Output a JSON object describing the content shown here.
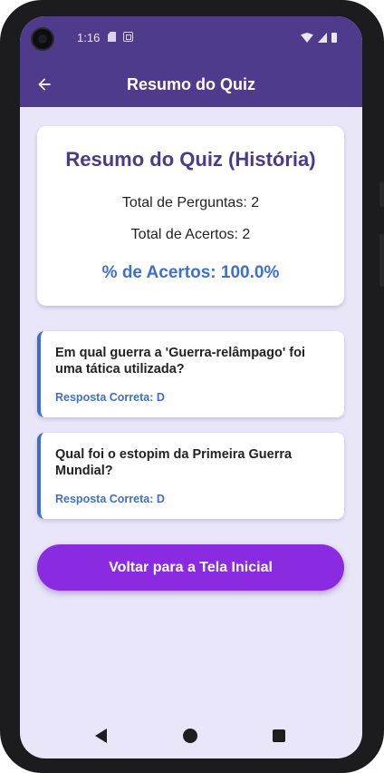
{
  "status_bar": {
    "time": "1:16"
  },
  "app_bar": {
    "title": "Resumo do Quiz"
  },
  "summary": {
    "title": "Resumo do Quiz (História)",
    "total_questions": "Total de Perguntas: 2",
    "total_correct": "Total de Acertos: 2",
    "percent_correct": "% de Acertos: 100.0%"
  },
  "questions": [
    {
      "text": "Em qual guerra a 'Guerra-relâmpago' foi uma tática utilizada?",
      "answer": "Resposta Correta: D"
    },
    {
      "text": "Qual foi o estopim da Primeira Guerra Mundial?",
      "answer": "Resposta Correta: D"
    }
  ],
  "home_button": {
    "label": "Voltar para a Tela Inicial"
  },
  "colors": {
    "app_bar": "#4f3b8b",
    "background": "#e8e6f8",
    "accent_blue": "#3d6fd1",
    "button_purple": "#8a2be2",
    "title_purple": "#4b3a8c"
  },
  "icons": {
    "back": "arrow-left-icon",
    "nav_back": "triangle-back-icon",
    "nav_home": "circle-home-icon",
    "nav_recents": "square-recents-icon"
  }
}
